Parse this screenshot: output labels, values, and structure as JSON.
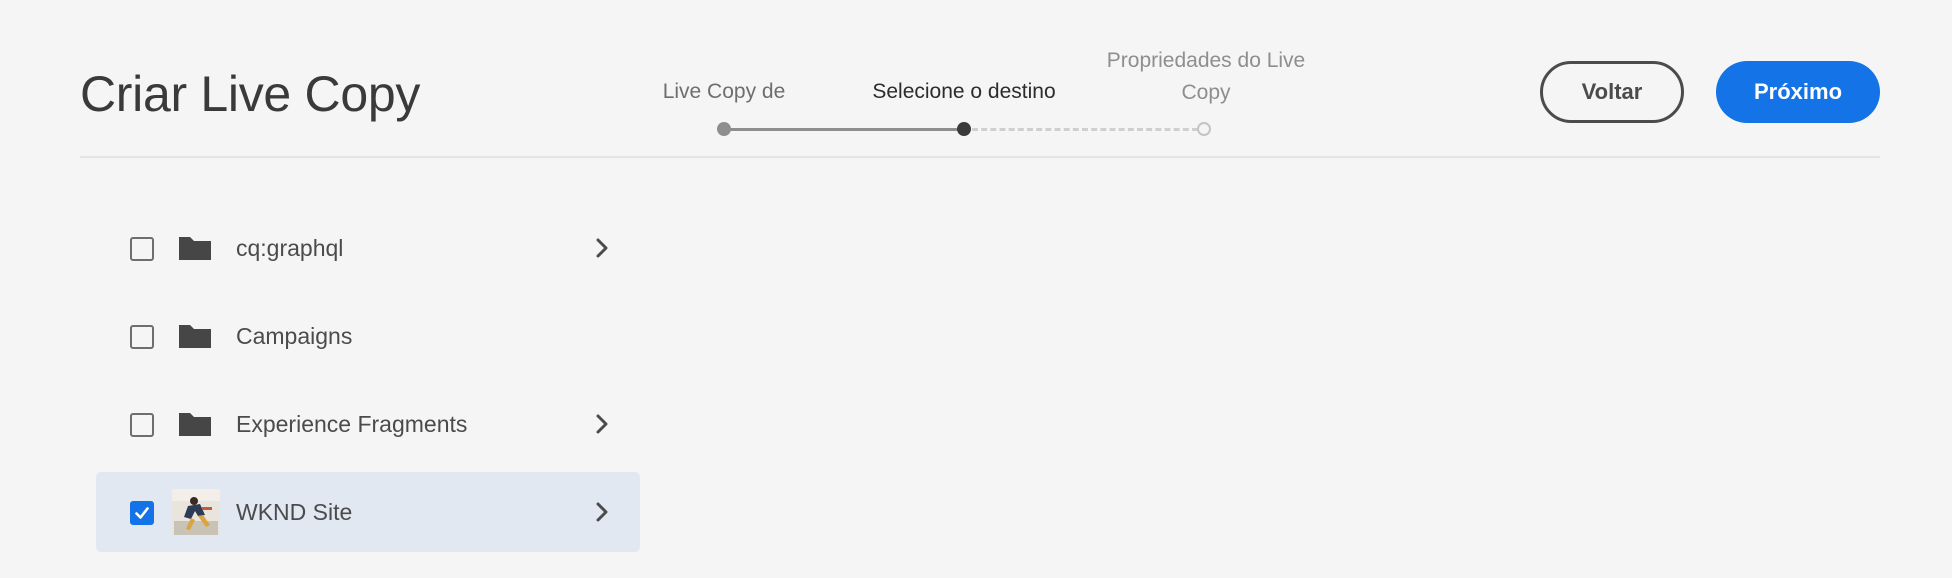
{
  "header": {
    "title": "Criar Live Copy"
  },
  "wizard": {
    "steps": [
      {
        "label": "Live Copy de",
        "state": "done"
      },
      {
        "label": "Selecione o destino",
        "state": "current"
      },
      {
        "label": "Propriedades do Live Copy",
        "state": "future"
      }
    ]
  },
  "actions": {
    "back_label": "Voltar",
    "next_label": "Próximo"
  },
  "list": {
    "items": [
      {
        "label": "cq:graphql",
        "icon": "folder-icon",
        "checked": false,
        "has_children": true
      },
      {
        "label": "Campaigns",
        "icon": "folder-icon",
        "checked": false,
        "has_children": false
      },
      {
        "label": "Experience Fragments",
        "icon": "folder-icon",
        "checked": false,
        "has_children": true
      },
      {
        "label": "WKND Site",
        "icon": "site-thumbnail",
        "checked": true,
        "has_children": true
      }
    ]
  },
  "colors": {
    "accent": "#1473e6",
    "background": "#f5f5f5",
    "selected_row": "#e1e8f2"
  }
}
